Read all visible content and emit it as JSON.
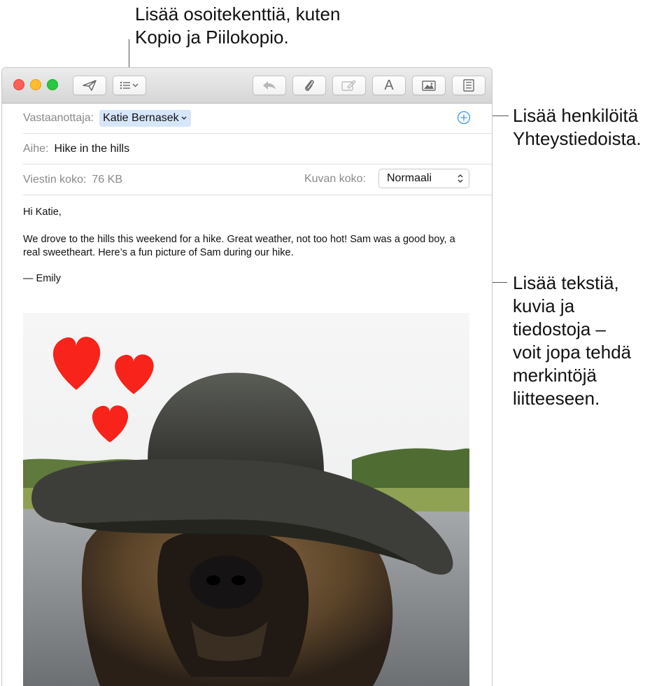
{
  "callouts": {
    "top": [
      "Lisää osoitekenttiä, kuten",
      "Kopio ja Piilokopio."
    ],
    "contacts": [
      "Lisää henkilöitä",
      "Yhteystiedoista."
    ],
    "content": [
      "Lisää tekstiä,",
      "kuvia ja",
      "tiedostoja –",
      "voit jopa tehdä",
      "merkintöjä",
      "liitteeseen."
    ]
  },
  "toolbar": {
    "buttons": [
      {
        "name": "send-button",
        "icon": "paper-plane-icon"
      },
      {
        "name": "header-fields-button",
        "icon": "list-icon"
      },
      {
        "name": "reply-button",
        "icon": "reply-arrow-icon"
      },
      {
        "name": "attach-button",
        "icon": "paperclip-icon"
      },
      {
        "name": "markup-button",
        "icon": "markup-icon"
      },
      {
        "name": "format-button",
        "icon": "font-icon",
        "label": "A"
      },
      {
        "name": "photo-browser-button",
        "icon": "photo-icon"
      },
      {
        "name": "stationery-button",
        "icon": "stationery-icon"
      }
    ]
  },
  "header": {
    "to_label": "Vastaanottaja:",
    "to_value": "Katie Bernasek",
    "subject_label": "Aihe:",
    "subject_value": "Hike in the hills",
    "size_label": "Viestin koko:",
    "size_value": "76 KB",
    "image_size_label": "Kuvan koko:",
    "image_size_value": "Normaali"
  },
  "message": {
    "greeting": "Hi Katie,",
    "paragraph": "We drove to the hills this weekend for a hike. Great weather, not too hot! Sam was a good boy, a real sweetheart. Here’s a fun picture of Sam during our hike.",
    "signature": "— Emily"
  },
  "colors": {
    "close": "#fe5f57",
    "minimize": "#febc2e",
    "zoom": "#28c840",
    "accent": "#3d9be9",
    "heart": "#f8231a",
    "token_bg": "#d6e6fb"
  }
}
